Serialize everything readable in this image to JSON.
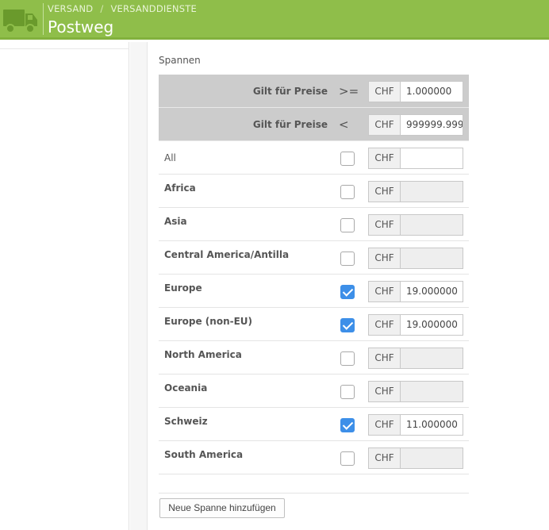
{
  "header": {
    "breadcrumb": [
      "VERSAND",
      "VERSANDDIENSTE"
    ],
    "breadcrumb_sep": "/",
    "title": "Postweg",
    "icon": "truck-icon",
    "accent": "#8fbe4a"
  },
  "section": {
    "title": "Spannen"
  },
  "ranges": [
    {
      "label": "Gilt für Preise",
      "operator": ">=",
      "currency": "CHF",
      "value": "1.000000"
    },
    {
      "label": "Gilt für Preise",
      "operator": "<",
      "currency": "CHF",
      "value": "999999.999"
    }
  ],
  "zones": [
    {
      "label": "All",
      "checked": false,
      "currency": "CHF",
      "value": "",
      "enabled": true
    },
    {
      "label": "Africa",
      "checked": false,
      "currency": "CHF",
      "value": "",
      "enabled": false
    },
    {
      "label": "Asia",
      "checked": false,
      "currency": "CHF",
      "value": "",
      "enabled": false
    },
    {
      "label": "Central America/Antilla",
      "checked": false,
      "currency": "CHF",
      "value": "",
      "enabled": false
    },
    {
      "label": "Europe",
      "checked": true,
      "currency": "CHF",
      "value": "19.000000",
      "enabled": true
    },
    {
      "label": "Europe (non-EU)",
      "checked": true,
      "currency": "CHF",
      "value": "19.000000",
      "enabled": true
    },
    {
      "label": "North America",
      "checked": false,
      "currency": "CHF",
      "value": "",
      "enabled": false
    },
    {
      "label": "Oceania",
      "checked": false,
      "currency": "CHF",
      "value": "",
      "enabled": false
    },
    {
      "label": "Schweiz",
      "checked": true,
      "currency": "CHF",
      "value": "11.000000",
      "enabled": true
    },
    {
      "label": "South America",
      "checked": false,
      "currency": "CHF",
      "value": "",
      "enabled": false
    }
  ],
  "actions": {
    "add_range_label": "Neue Spanne hinzufügen"
  },
  "colors": {
    "checkbox_on": "#3d8fe8",
    "range_row_bg": "#cccccc"
  }
}
